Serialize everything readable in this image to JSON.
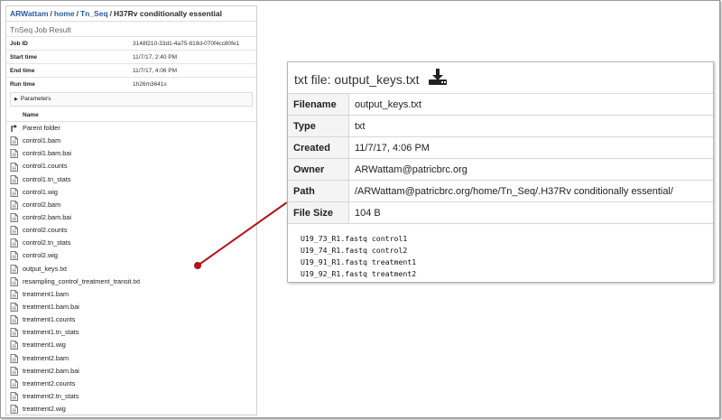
{
  "breadcrumb": {
    "user": "ARWattam",
    "home": "home",
    "folder": "Tn_Seq",
    "current": "H37Rv conditionally essential"
  },
  "job": {
    "title": "TnSeq Job Result",
    "fields": [
      {
        "label": "Job ID",
        "value": "3148f210-33d1-4a75-819d-070f4cc80fe1"
      },
      {
        "label": "Start time",
        "value": "11/7/17, 2:40 PM"
      },
      {
        "label": "End time",
        "value": "11/7/17, 4:06 PM"
      },
      {
        "label": "Run time",
        "value": "1h26m3641s"
      }
    ],
    "parameters_label": "Parameters"
  },
  "file_list": {
    "column_name": "Name",
    "items": [
      {
        "name": "Parent folder",
        "icon": "parent-folder-icon"
      },
      {
        "name": "control1.bam",
        "icon": "file-icon"
      },
      {
        "name": "control1.bam.bai",
        "icon": "file-icon"
      },
      {
        "name": "control1.counts",
        "icon": "file-icon"
      },
      {
        "name": "control1.tn_stats",
        "icon": "file-icon"
      },
      {
        "name": "control1.wig",
        "icon": "file-icon"
      },
      {
        "name": "control2.bam",
        "icon": "file-icon"
      },
      {
        "name": "control2.bam.bai",
        "icon": "file-icon"
      },
      {
        "name": "control2.counts",
        "icon": "file-icon"
      },
      {
        "name": "control2.tn_stats",
        "icon": "file-icon"
      },
      {
        "name": "control2.wig",
        "icon": "file-icon"
      },
      {
        "name": "output_keys.txt",
        "icon": "file-icon"
      },
      {
        "name": "resampling_control_treatment_transit.txt",
        "icon": "file-icon"
      },
      {
        "name": "treatment1.bam",
        "icon": "file-icon"
      },
      {
        "name": "treatment1.bam.bai",
        "icon": "file-icon"
      },
      {
        "name": "treatment1.counts",
        "icon": "file-icon"
      },
      {
        "name": "treatment1.tn_stats",
        "icon": "file-icon"
      },
      {
        "name": "treatment1.wig",
        "icon": "file-icon"
      },
      {
        "name": "treatment2.bam",
        "icon": "file-icon"
      },
      {
        "name": "treatment2.bam.bai",
        "icon": "file-icon"
      },
      {
        "name": "treatment2.counts",
        "icon": "file-icon"
      },
      {
        "name": "treatment2.tn_stats",
        "icon": "file-icon"
      },
      {
        "name": "treatment2.wig",
        "icon": "file-icon"
      }
    ]
  },
  "preview": {
    "title_prefix": "txt file:",
    "filename": "output_keys.txt",
    "download_icon": "download-icon",
    "fields": [
      {
        "label": "Filename",
        "value": "output_keys.txt"
      },
      {
        "label": "Type",
        "value": "txt"
      },
      {
        "label": "Created",
        "value": "11/7/17, 4:06 PM"
      },
      {
        "label": "Owner",
        "value": "ARWattam@patricbrc.org"
      },
      {
        "label": "Path",
        "value": "/ARWattam@patricbrc.org/home/Tn_Seq/.H37Rv conditionally essential/"
      },
      {
        "label": "File Size",
        "value": "104 B"
      }
    ],
    "content_lines": [
      "U19_73_R1.fastq control1",
      "U19_74_R1.fastq control2",
      "U19_91_R1.fastq treatment1",
      "U19_92_R1.fastq treatment2"
    ]
  },
  "colors": {
    "link": "#2c5aa0",
    "connector": "#b5121b"
  }
}
